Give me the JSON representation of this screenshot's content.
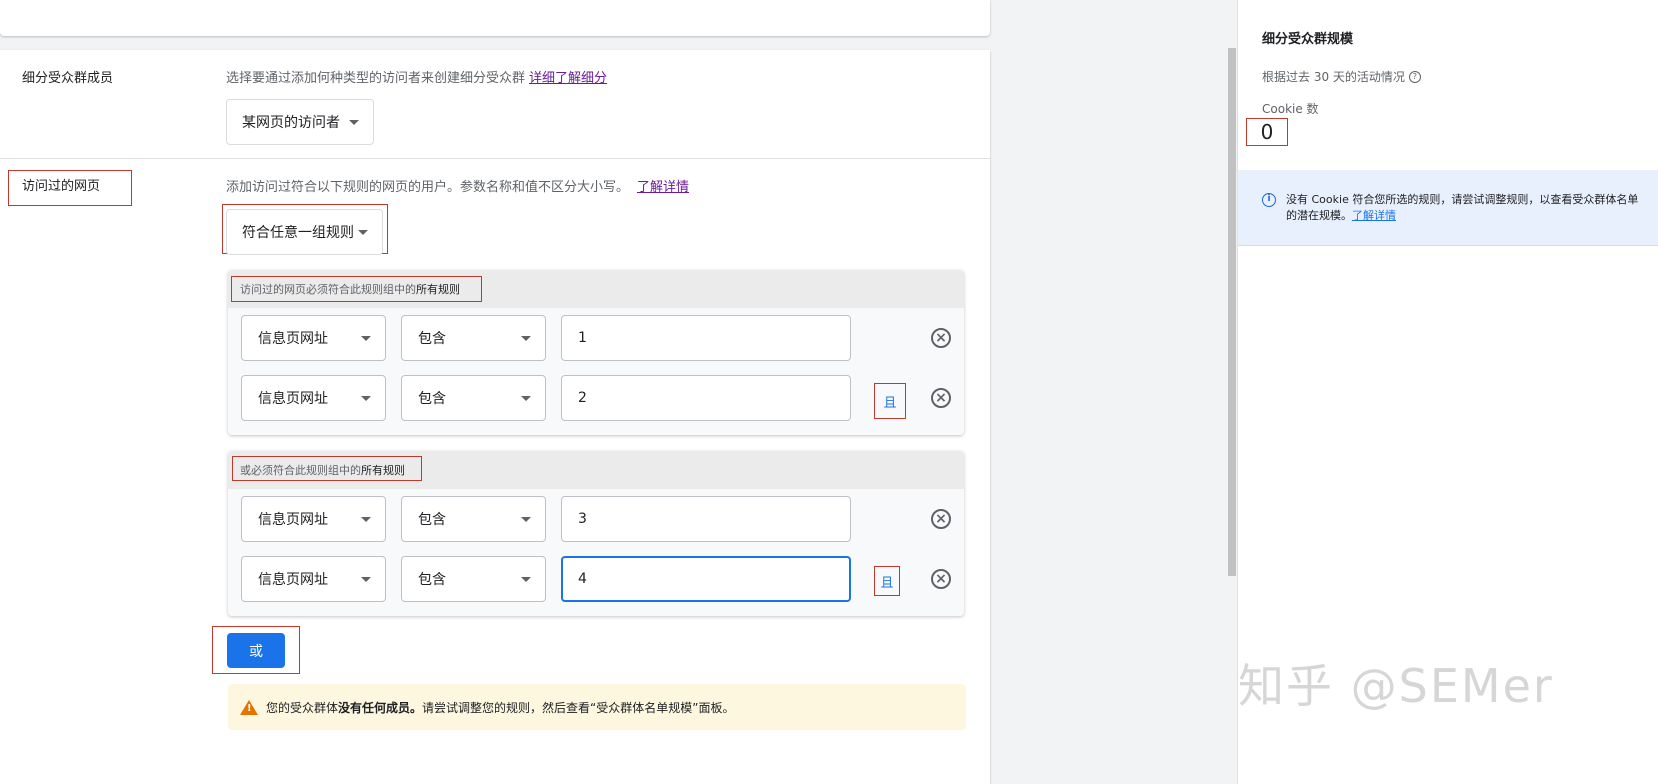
{
  "segment_members": {
    "label": "细分受众群成员",
    "desc": "选择要通过添加何种类型的访问者来创建细分受众群",
    "learn_link": "详细了解细分",
    "visitor_type": "某网页的访问者"
  },
  "visited_pages": {
    "label": "访问过的网页",
    "desc": "添加访问过符合以下规则的网页的用户。参数名称和值不区分大小写。",
    "learn_link": "了解详情",
    "match_type": "符合任意一组规则",
    "groups": [
      {
        "header_prefix": "访问过的网页必须符合此规则组中的",
        "header_bold": "所有规则",
        "rules": [
          {
            "field": "信息页网址",
            "operator": "包含",
            "value": "1"
          },
          {
            "field": "信息页网址",
            "operator": "包含",
            "value": "2",
            "and": "且"
          }
        ]
      },
      {
        "header_prefix": "或必须符合此规则组中的",
        "header_bold": "所有规则",
        "rules": [
          {
            "field": "信息页网址",
            "operator": "包含",
            "value": "3"
          },
          {
            "field": "信息页网址",
            "operator": "包含",
            "value": "4",
            "and": "且"
          }
        ]
      }
    ],
    "or_button": "或"
  },
  "warning": {
    "prefix": "您的受众群体",
    "bold": "没有任何成员。",
    "suffix": "请尝试调整您的规则，然后查看“受众群体名单规模”面板。"
  },
  "side_panel": {
    "title": "细分受众群规模",
    "subtitle": "根据过去 30 天的活动情况",
    "cookie_label": "Cookie 数",
    "cookie_count": "0",
    "info_text": "没有 Cookie 符合您所选的规则，请尝试调整规则，以查看受众群体名单的潜在规模。",
    "info_link": "了解详情"
  },
  "watermark": "知乎 @SEMer"
}
